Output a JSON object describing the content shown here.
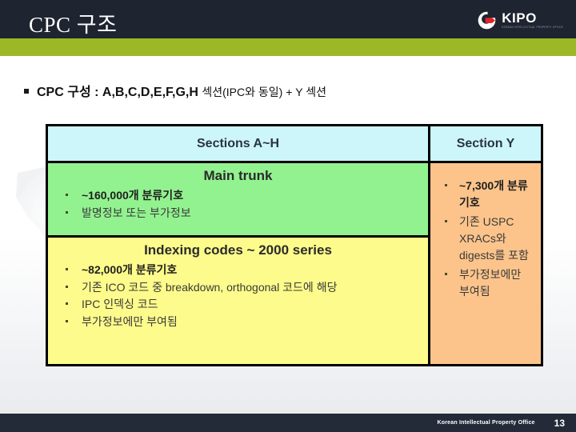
{
  "header": {
    "title": "CPC 구조",
    "logo": {
      "word": "KIPO",
      "subtitle": "KOREAN INTELLECTUAL PROPERTY OFFICE",
      "mark_name": "kipo-swirl-logo"
    },
    "bar_color": "#1e2430",
    "accent_color": "#9cb826"
  },
  "lead": {
    "bullet": "§",
    "bold_part": "CPC 구성 :",
    "rest": " A,B,C,D,E,F,G,H ",
    "rest2": "섹션(IPC와 동일) + Y 섹션"
  },
  "table": {
    "columns": [
      {
        "header": "Sections A~H"
      },
      {
        "header": "Section Y"
      }
    ],
    "left_column": {
      "sections": [
        {
          "title": "Main trunk",
          "background": "#92f28f",
          "items": [
            {
              "text": "~160,000개 분류기호",
              "bold": true
            },
            {
              "text": "발명정보 또는 부가정보",
              "bold": false
            }
          ]
        },
        {
          "title": "Indexing codes ~ 2000 series",
          "background": "#fdfb8b",
          "items": [
            {
              "text": "~82,000개 분류기호",
              "bold": true
            },
            {
              "text": "기존 ICO 코드 중 breakdown, orthogonal 코드에 해당",
              "bold": false
            },
            {
              "text": "IPC 인덱싱 코드",
              "bold": false
            },
            {
              "text": "부가정보에만 부여됨",
              "bold": false
            }
          ]
        }
      ]
    },
    "right_column": {
      "background": "#fcc48b",
      "items": [
        {
          "text": "~7,300개 분류기호",
          "bold": true
        },
        {
          "text": "기존 USPC XRACs와 digests를 포함",
          "bold": false
        },
        {
          "text": "부가정보에만 부여됨",
          "bold": false
        }
      ]
    },
    "header_background": "#cdf6fb"
  },
  "footer": {
    "organization": "Korean Intellectual Property Office",
    "page_number": "13"
  }
}
